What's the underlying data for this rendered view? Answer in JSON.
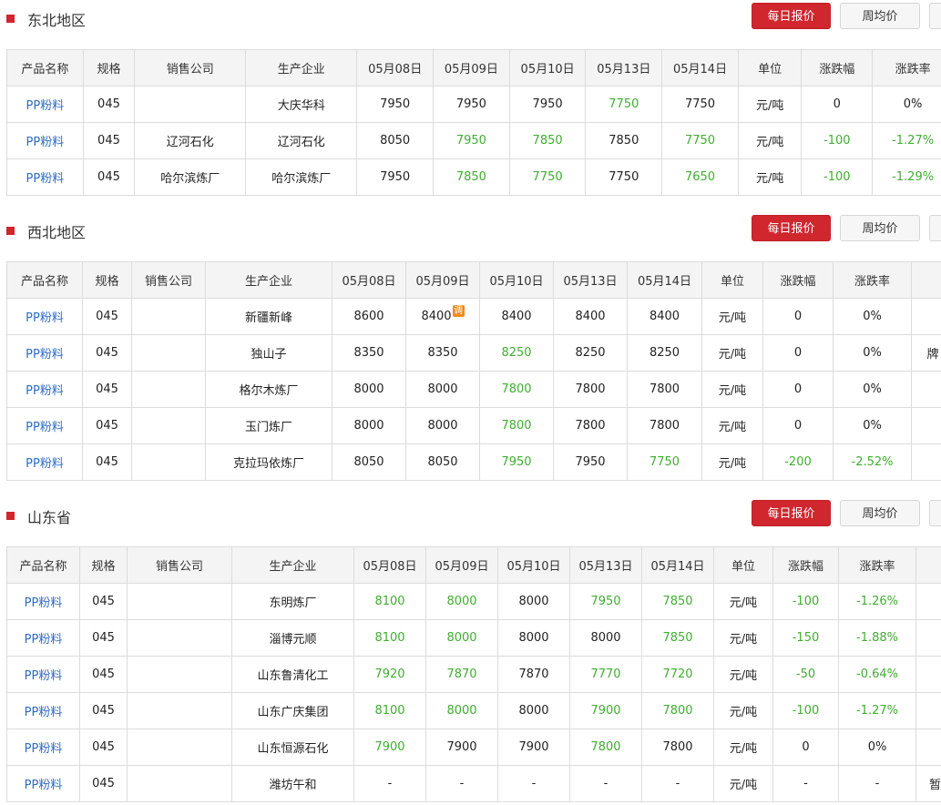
{
  "buttons": {
    "daily": "每日报价",
    "weekly": "周均价"
  },
  "colors": {
    "accent": "#d0262e",
    "link": "#2d6cc7",
    "down": "#3fae2f"
  },
  "sections": [
    {
      "title": "东北地区",
      "headers": [
        "产品名称",
        "规格",
        "销售公司",
        "生产企业",
        "05月08日",
        "05月09日",
        "05月10日",
        "05月13日",
        "05月14日",
        "单位",
        "涨跌幅",
        "涨跌率"
      ],
      "rows": [
        {
          "cells": [
            "PP粉料",
            "045",
            "",
            "大庆华科",
            "7950",
            "7950",
            "7950",
            "7750",
            "7750",
            "元/吨",
            "0",
            "0%"
          ],
          "down": [
            7
          ]
        },
        {
          "cells": [
            "PP粉料",
            "045",
            "辽河石化",
            "辽河石化",
            "8050",
            "7950",
            "7850",
            "7850",
            "7750",
            "元/吨",
            "-100",
            "-1.27%"
          ],
          "down": [
            5,
            6,
            8,
            10,
            11
          ]
        },
        {
          "cells": [
            "PP粉料",
            "045",
            "哈尔滨炼厂",
            "哈尔滨炼厂",
            "7950",
            "7850",
            "7750",
            "7750",
            "7650",
            "元/吨",
            "-100",
            "-1.29%"
          ],
          "down": [
            5,
            6,
            8,
            10,
            11
          ]
        }
      ]
    },
    {
      "title": "西北地区",
      "headers": [
        "产品名称",
        "规格",
        "销售公司",
        "生产企业",
        "05月08日",
        "05月09日",
        "05月10日",
        "05月13日",
        "05月14日",
        "单位",
        "涨跌幅",
        "涨跌率",
        ""
      ],
      "rows": [
        {
          "cells": [
            "PP粉料",
            "045",
            "",
            "新疆新峰",
            "8600",
            "8400",
            "8400",
            "8400",
            "8400",
            "元/吨",
            "0",
            "0%",
            ""
          ],
          "down": [],
          "badge_col": 5,
          "badge": "调"
        },
        {
          "cells": [
            "PP粉料",
            "045",
            "",
            "独山子",
            "8350",
            "8350",
            "8250",
            "8250",
            "8250",
            "元/吨",
            "0",
            "0%",
            "牌"
          ],
          "down": [
            6
          ]
        },
        {
          "cells": [
            "PP粉料",
            "045",
            "",
            "格尔木炼厂",
            "8000",
            "8000",
            "7800",
            "7800",
            "7800",
            "元/吨",
            "0",
            "0%",
            ""
          ],
          "down": [
            6
          ]
        },
        {
          "cells": [
            "PP粉料",
            "045",
            "",
            "玉门炼厂",
            "8000",
            "8000",
            "7800",
            "7800",
            "7800",
            "元/吨",
            "0",
            "0%",
            ""
          ],
          "down": [
            6
          ]
        },
        {
          "cells": [
            "PP粉料",
            "045",
            "",
            "克拉玛依炼厂",
            "8050",
            "8050",
            "7950",
            "7950",
            "7750",
            "元/吨",
            "-200",
            "-2.52%",
            ""
          ],
          "down": [
            6,
            8,
            10,
            11
          ]
        }
      ]
    },
    {
      "title": "山东省",
      "headers": [
        "产品名称",
        "规格",
        "销售公司",
        "生产企业",
        "05月08日",
        "05月09日",
        "05月10日",
        "05月13日",
        "05月14日",
        "单位",
        "涨跌幅",
        "涨跌率",
        ""
      ],
      "rows": [
        {
          "cells": [
            "PP粉料",
            "045",
            "",
            "东明炼厂",
            "8100",
            "8000",
            "8000",
            "7950",
            "7850",
            "元/吨",
            "-100",
            "-1.26%",
            ""
          ],
          "down": [
            4,
            5,
            7,
            8,
            10,
            11
          ]
        },
        {
          "cells": [
            "PP粉料",
            "045",
            "",
            "淄博元顺",
            "8100",
            "8000",
            "8000",
            "8000",
            "7850",
            "元/吨",
            "-150",
            "-1.88%",
            ""
          ],
          "down": [
            4,
            5,
            8,
            10,
            11
          ]
        },
        {
          "cells": [
            "PP粉料",
            "045",
            "",
            "山东鲁清化工",
            "7920",
            "7870",
            "7870",
            "7770",
            "7720",
            "元/吨",
            "-50",
            "-0.64%",
            ""
          ],
          "down": [
            4,
            5,
            7,
            8,
            10,
            11
          ]
        },
        {
          "cells": [
            "PP粉料",
            "045",
            "",
            "山东广庆集团",
            "8100",
            "8000",
            "8000",
            "7900",
            "7800",
            "元/吨",
            "-100",
            "-1.27%",
            ""
          ],
          "down": [
            4,
            5,
            7,
            8,
            10,
            11
          ]
        },
        {
          "cells": [
            "PP粉料",
            "045",
            "",
            "山东恒源石化",
            "7900",
            "7900",
            "7900",
            "7800",
            "7800",
            "元/吨",
            "0",
            "0%",
            ""
          ],
          "down": [
            4,
            7
          ]
        },
        {
          "cells": [
            "PP粉料",
            "045",
            "",
            "潍坊午和",
            "-",
            "-",
            "-",
            "-",
            "-",
            "元/吨",
            "-",
            "-",
            "暂"
          ],
          "down": []
        }
      ]
    }
  ]
}
